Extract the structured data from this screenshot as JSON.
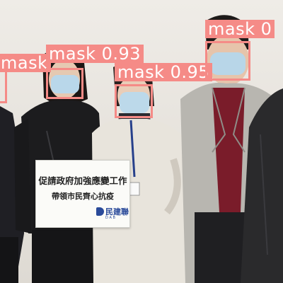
{
  "photo": {
    "people": [
      {
        "name": "person-far-left",
        "jacket": "#1f1f24"
      },
      {
        "name": "person-left",
        "jacket": "#1c1c1e"
      },
      {
        "name": "person-center",
        "jacket": "#e8e4dc"
      },
      {
        "name": "person-right",
        "jacket": "#b8b6b0"
      },
      {
        "name": "person-far-right",
        "jacket": "#2a2a2c"
      }
    ],
    "sign": {
      "line1": "促請政府加強應變工作",
      "line2": "帶領市民齊心抗疫",
      "logo_text": "民建聯",
      "logo_sub": "D A B"
    }
  },
  "detections": [
    {
      "id": "det-1",
      "label": "mask",
      "score": "",
      "text": "mask"
    },
    {
      "id": "det-2",
      "label": "mask",
      "score": "0.93",
      "text": "mask 0.93"
    },
    {
      "id": "det-3",
      "label": "mask",
      "score": "0.95",
      "text": "mask 0.95"
    },
    {
      "id": "det-4",
      "label": "mask",
      "score": "",
      "text": "mask 0"
    }
  ],
  "colors": {
    "box": "#f58b87",
    "label_text": "#ffffff",
    "mask": "#b9d7ea"
  }
}
